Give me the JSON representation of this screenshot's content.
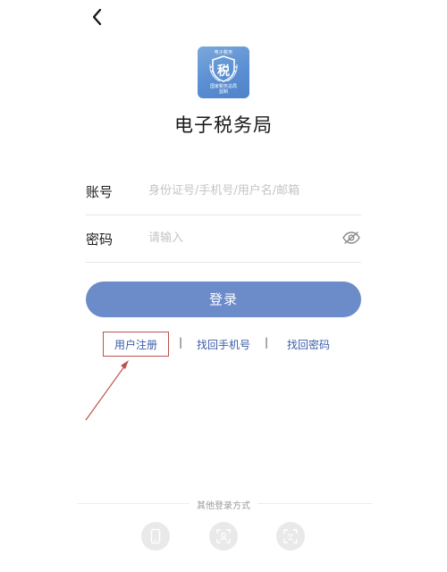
{
  "header": {
    "back_icon": "chevron-left-icon"
  },
  "logo": {
    "top_text": "电子税务",
    "emblem_char": "税",
    "bottom_line1": "国家税务总局",
    "bottom_line2": "监制"
  },
  "app_title": "电子税务局",
  "form": {
    "account_label": "账号",
    "account_placeholder": "身份证号/手机号/用户名/邮箱",
    "account_value": "",
    "password_label": "密码",
    "password_placeholder": "请输入",
    "password_value": "",
    "password_toggle_icon": "eye-off-icon"
  },
  "login_button_label": "登录",
  "links": {
    "register": "用户注册",
    "separator": "|",
    "find_phone": "找回手机号",
    "find_password": "找回密码"
  },
  "other_login": {
    "label": "其他登录方式",
    "methods": [
      {
        "icon": "phone-icon"
      },
      {
        "icon": "face-id-icon"
      },
      {
        "icon": "face-scan-icon"
      }
    ]
  },
  "colors": {
    "primary_button": "#6b8bc9",
    "link": "#3a5ca8",
    "annotation": "#c0504d"
  }
}
